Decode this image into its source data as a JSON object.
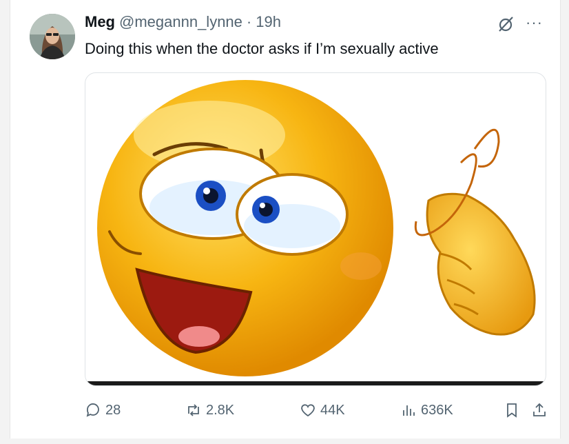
{
  "tweet": {
    "author_name": "Meg",
    "handle": "@megannn_lynne",
    "separator": "·",
    "time": "19h",
    "text": "Doing this when the doctor asks if I’m sexually active",
    "more_label": "···"
  },
  "actions": {
    "replies": "28",
    "reposts": "2.8K",
    "likes": "44K",
    "views": "636K"
  },
  "colors": {
    "muted": "#536471",
    "text": "#0f1419",
    "emoji_yellow": "#f7b512",
    "emoji_orange": "#e08a00"
  },
  "icons": [
    "grok-icon",
    "more-icon",
    "reply-icon",
    "repost-icon",
    "like-icon",
    "views-icon",
    "bookmark-icon",
    "share-icon"
  ]
}
